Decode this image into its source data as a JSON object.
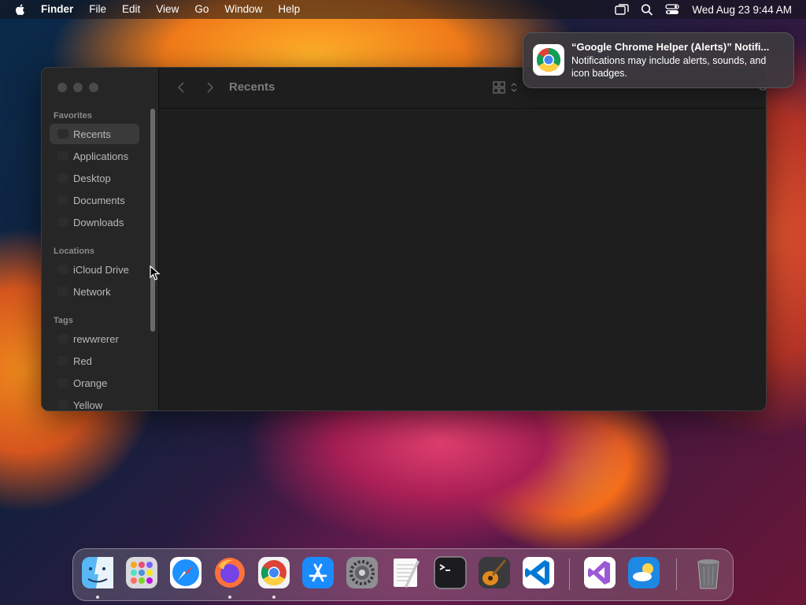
{
  "menubar": {
    "app": "Finder",
    "items": [
      "File",
      "Edit",
      "View",
      "Go",
      "Window",
      "Help"
    ],
    "clock": "Wed Aug 23  9:44 AM",
    "status_icons": [
      "screen-mirroring-icon",
      "search-icon",
      "control-center-icon"
    ]
  },
  "finder": {
    "title": "Recents",
    "sections": {
      "favorites": "Favorites",
      "locations": "Locations",
      "tags": "Tags"
    },
    "favorites": [
      "Recents",
      "Applications",
      "Desktop",
      "Documents",
      "Downloads"
    ],
    "locations": [
      "iCloud Drive",
      "Network"
    ],
    "tags": [
      "rewwrerer",
      "Red",
      "Orange",
      "Yellow"
    ]
  },
  "notification": {
    "title": "“Google Chrome Helper (Alerts)” Notifi...",
    "body": "Notifications may include alerts, sounds, and icon badges."
  },
  "dock": {
    "apps": [
      "Finder",
      "Launchpad",
      "Safari",
      "Firefox",
      "Google Chrome",
      "App Store",
      "System Settings",
      "TextEdit",
      "Terminal",
      "GarageBand",
      "Visual Studio Code",
      "Visual Studio",
      "Weather",
      "Trash"
    ],
    "running": [
      "Finder",
      "Firefox",
      "Google Chrome"
    ]
  }
}
